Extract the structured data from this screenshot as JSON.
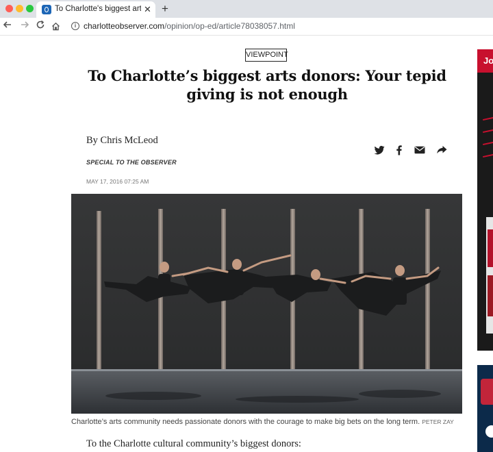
{
  "browser": {
    "tab_title": "To Charlotte's biggest arts donors",
    "tab_close": "✕",
    "new_tab": "+",
    "url_host": "charlotteobserver.com",
    "url_path": "/opinion/op-ed/article78038057.html",
    "icons": [
      "back-arrow-icon",
      "forward-arrow-icon",
      "reload-icon",
      "home-icon",
      "info-icon"
    ]
  },
  "article": {
    "kicker": "VIEWPOINT",
    "headline": "To Charlotte’s biggest arts donors: Your tepid giving is not enough",
    "byline": "By Chris McLeod",
    "byline_sub": "SPECIAL TO THE OBSERVER",
    "dateline": "MAY 17, 2016 07:25 AM",
    "share_icons": [
      "twitter-icon",
      "facebook-icon",
      "email-icon",
      "share-icon"
    ],
    "caption": "Charlotte’s arts community needs passionate donors with the courage to make big bets on the long term.",
    "credit": "PETER ZAY",
    "lede": "To the Charlotte cultural community’s biggest donors:"
  },
  "ads": {
    "ad1_text": "Jo"
  },
  "colors": {
    "tabbar_bg": "#dee1e6",
    "kicker_border": "#222222",
    "ad_red": "#c8102e",
    "photo_bg": "#2a2b2c"
  }
}
